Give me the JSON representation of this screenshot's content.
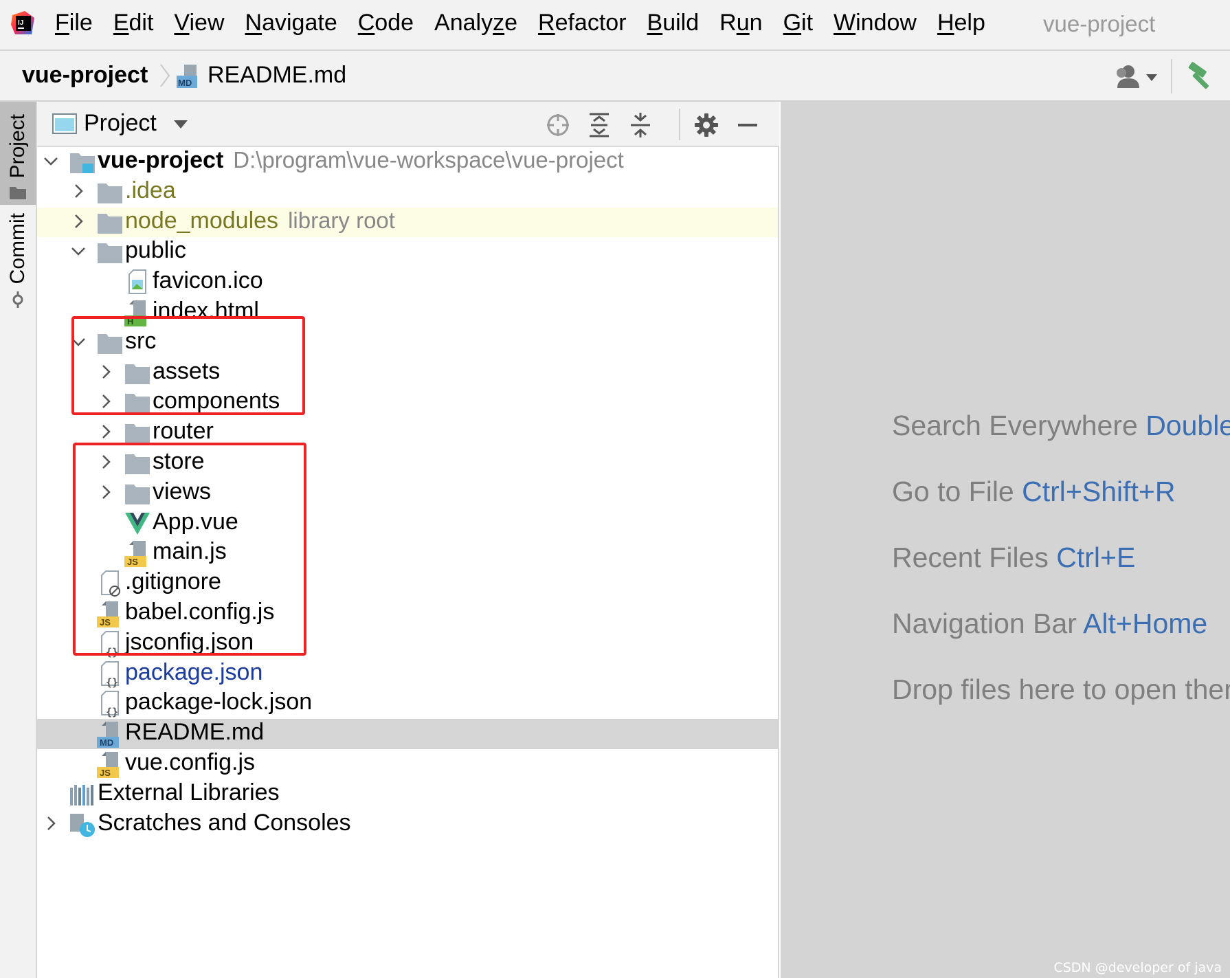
{
  "menubar": {
    "items": [
      {
        "mnemonic": "F",
        "rest": "ile"
      },
      {
        "mnemonic": "E",
        "rest": "dit"
      },
      {
        "mnemonic": "V",
        "rest": "iew"
      },
      {
        "mnemonic": "N",
        "rest": "avigate"
      },
      {
        "mnemonic": "C",
        "rest": "ode"
      },
      {
        "prefix": "Analy",
        "mnemonic": "z",
        "rest": "e"
      },
      {
        "mnemonic": "R",
        "rest": "efactor"
      },
      {
        "mnemonic": "B",
        "rest": "uild"
      },
      {
        "prefix": "R",
        "mnemonic": "u",
        "rest": "n"
      },
      {
        "mnemonic": "G",
        "rest": "it"
      },
      {
        "mnemonic": "W",
        "rest": "indow"
      },
      {
        "mnemonic": "H",
        "rest": "elp"
      }
    ],
    "window_title": "vue-project"
  },
  "navbar": {
    "project": "vue-project",
    "file": "README.md",
    "file_icon_text": "MD"
  },
  "tool_stripe": {
    "project_tab": "Project",
    "commit_tab": "Commit"
  },
  "project_panel": {
    "title": "Project",
    "header_buttons": [
      "locate-icon",
      "expand-all-icon",
      "collapse-all-icon",
      "gear-icon",
      "hide-icon"
    ]
  },
  "tree": [
    {
      "label": "vue-project",
      "hint": "D:\\program\\vue-workspace\\vue-project",
      "icon": "module",
      "depth": 0,
      "arrow": "down",
      "bold": true
    },
    {
      "label": ".idea",
      "icon": "folder",
      "depth": 1,
      "arrow": "right",
      "color": "olive"
    },
    {
      "label": "node_modules",
      "hint": "library root",
      "icon": "folder",
      "depth": 1,
      "arrow": "right",
      "color": "olive",
      "lib": true
    },
    {
      "label": "public",
      "icon": "folder",
      "depth": 1,
      "arrow": "down"
    },
    {
      "label": "favicon.ico",
      "icon": "image",
      "depth": 2
    },
    {
      "label": "index.html",
      "icon": "html",
      "icon_text": "H",
      "depth": 2
    },
    {
      "label": "src",
      "icon": "folder",
      "depth": 1,
      "arrow": "down"
    },
    {
      "label": "assets",
      "icon": "folder",
      "depth": 2,
      "arrow": "right"
    },
    {
      "label": "components",
      "icon": "folder",
      "depth": 2,
      "arrow": "right"
    },
    {
      "label": "router",
      "icon": "folder",
      "depth": 2,
      "arrow": "right"
    },
    {
      "label": "store",
      "icon": "folder",
      "depth": 2,
      "arrow": "right"
    },
    {
      "label": "views",
      "icon": "folder",
      "depth": 2,
      "arrow": "right"
    },
    {
      "label": "App.vue",
      "icon": "vue",
      "depth": 2
    },
    {
      "label": "main.js",
      "icon": "js",
      "icon_text": "JS",
      "depth": 2
    },
    {
      "label": ".gitignore",
      "icon": "ignore",
      "depth": 1
    },
    {
      "label": "babel.config.js",
      "icon": "js",
      "icon_text": "JS",
      "depth": 1
    },
    {
      "label": "jsconfig.json",
      "icon": "json",
      "depth": 1
    },
    {
      "label": "package.json",
      "icon": "json",
      "depth": 1,
      "color": "blue"
    },
    {
      "label": "package-lock.json",
      "icon": "json",
      "depth": 1
    },
    {
      "label": "README.md",
      "icon": "md",
      "icon_text": "MD",
      "depth": 1,
      "selected": true
    },
    {
      "label": "vue.config.js",
      "icon": "js",
      "icon_text": "JS",
      "depth": 1
    },
    {
      "label": "External Libraries",
      "icon": "libraries",
      "depth": 0
    },
    {
      "label": "Scratches and Consoles",
      "icon": "scratches",
      "depth": 0,
      "arrow": "right"
    }
  ],
  "editor_hints": [
    {
      "text": "Search Everywhere",
      "key": "Double Shift"
    },
    {
      "text": "Go to File",
      "key": "Ctrl+Shift+R"
    },
    {
      "text": "Recent Files",
      "key": "Ctrl+E"
    },
    {
      "text": "Navigation Bar",
      "key": "Alt+Home"
    },
    {
      "text": "Drop files here to open them",
      "key": ""
    }
  ],
  "watermark": "CSDN @developer of java",
  "colors": {
    "folder": "#a9b3bd",
    "highlight_box": "#ee2222",
    "hint_key": "#3c6eb4",
    "vue_green": "#41b883",
    "vue_dark": "#35495e",
    "js_badge": "#f2c94c",
    "md_badge": "#6aa9d8",
    "html_badge": "#62b543"
  }
}
